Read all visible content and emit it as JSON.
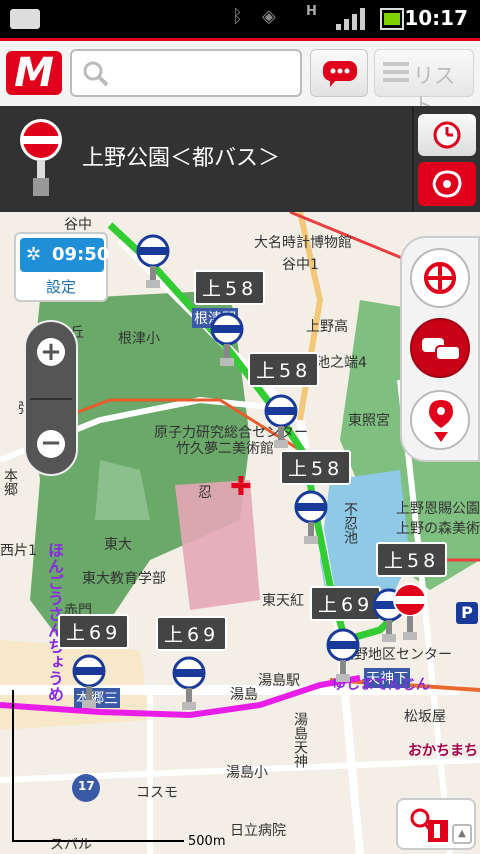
{
  "status_bar": {
    "time": "10:17"
  },
  "app_bar": {
    "logo": "M",
    "search": {
      "value": "",
      "placeholder": ""
    },
    "list_label": "リスト"
  },
  "stop": {
    "name": "上野公園＜都バス＞"
  },
  "time_widget": {
    "time": "09:50",
    "settings_label": "設定"
  },
  "bus_labels": [
    "上58",
    "上58",
    "上58",
    "上58",
    "上69",
    "上69",
    "上69"
  ],
  "map_labels": [
    "大名時計博物館",
    "谷中1",
    "根津駅",
    "根津小",
    "赤門",
    "上野高",
    "池之端4",
    "原子力研究総合センター",
    "竹久夢二美術館",
    "東照宮",
    "上野恩賜公園",
    "上野の森美術館",
    "忍",
    "不忍池",
    "東大",
    "東大教育学部",
    "東天紅",
    "湯島駅",
    "湯島",
    "松坂屋",
    "天神下",
    "湯島天神",
    "湯島小",
    "日立病院",
    "コスモ",
    "谷中",
    "向丘",
    "弥生",
    "本郷三",
    "西片1",
    "本郷",
    "ほんごうさんちょうめ",
    "ゆしまてんじん",
    "おかちまち",
    "スバル",
    "上野地区センター"
  ],
  "route_shield": "17",
  "scale": {
    "label": "500m"
  },
  "colors": {
    "accent": "#e0001b",
    "route_green": "#33cc33",
    "route_magenta": "#e81ee8",
    "park": "#5fa35f"
  }
}
